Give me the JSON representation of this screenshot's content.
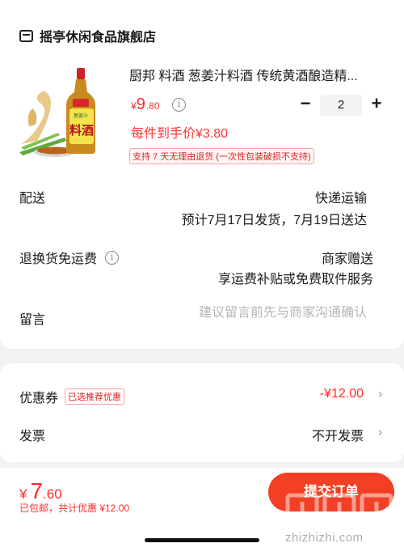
{
  "store": {
    "name": "摇亭休闲食品旗舰店",
    "icon": "store-icon"
  },
  "product": {
    "title": "厨邦 料酒 葱姜汁料酒 传统黄酒酿造精...",
    "price": {
      "symbol": "¥",
      "integer": "9",
      "decimal": ".80"
    },
    "quantity": "2",
    "hand_price": "每件到手价¥3.80",
    "refund_badge": "支持 7 天无理由退货 (一次性包装破损不支持)",
    "image_label": {
      "top": "葱姜汁",
      "main": "料酒"
    }
  },
  "delivery": {
    "label": "配送",
    "method": "快递运输",
    "eta": "预计7月17日发货，7月19日送达"
  },
  "returns": {
    "label": "退换货免运费",
    "value": "商家赠送",
    "sub": "享运费补贴或免费取件服务"
  },
  "note": {
    "label": "留言",
    "placeholder": "建议留言前先与商家沟通确认"
  },
  "coupon": {
    "label": "优惠券",
    "tag": "已选推荐优惠",
    "value": "-¥12.00"
  },
  "invoice": {
    "label": "发票",
    "value": "不开发票"
  },
  "footer": {
    "total": {
      "symbol": "¥",
      "integer": "7",
      "decimal": ".60"
    },
    "sub": "已包邮，共计优惠 ¥12.00",
    "submit_label": "提交订单"
  },
  "watermark": {
    "text": "zhizhizhi.com"
  },
  "colors": {
    "accent": "#f33f23",
    "price": "#ff2a2a",
    "muted": "#b5b5b5"
  }
}
